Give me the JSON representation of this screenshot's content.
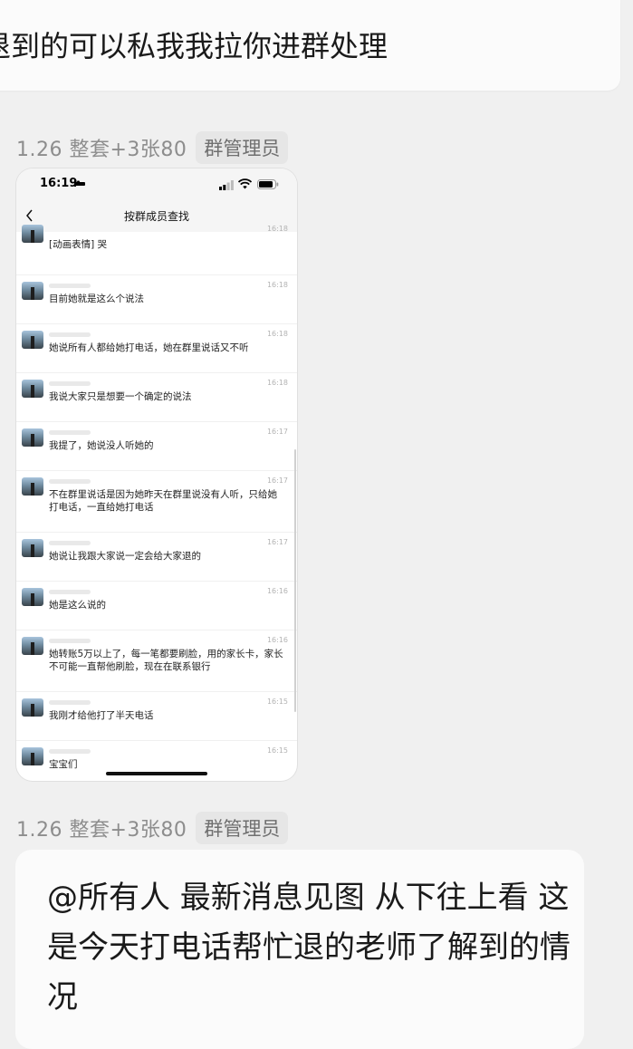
{
  "top_message": {
    "text": "退到的可以私我我拉你进群处理"
  },
  "sender": {
    "name": "1.26 整套+3张80",
    "role": "群管理员"
  },
  "screenshot": {
    "status_time": "16:19",
    "nav_title": "按群成员查找",
    "messages": [
      {
        "time": "16:18",
        "text": "[动画表情] 哭"
      },
      {
        "time": "16:18",
        "text": "目前她就是这么个说法"
      },
      {
        "time": "16:18",
        "text": "她说所有人都给她打电话，她在群里说话又不听"
      },
      {
        "time": "16:18",
        "text": "我说大家只是想要一个确定的说法"
      },
      {
        "time": "16:17",
        "text": "我提了，她说没人听她的"
      },
      {
        "time": "16:17",
        "text": "不在群里说话是因为她昨天在群里说没有人听，只给她打电话，一直给她打电话"
      },
      {
        "time": "16:17",
        "text": "她说让我跟大家说一定会给大家退的"
      },
      {
        "time": "16:16",
        "text": "她是这么说的"
      },
      {
        "time": "16:16",
        "text": "她转账5万以上了，每一笔都要刷脸，用的家长卡，家长不可能一直帮他刷脸，现在在联系银行"
      },
      {
        "time": "16:15",
        "text": "我刚才给他打了半天电话"
      },
      {
        "time": "16:15",
        "text": "宝宝们"
      }
    ]
  },
  "sender2": {
    "name": "1.26 整套+3张80",
    "role": "群管理员"
  },
  "announcement": {
    "text": "@所有人 最新消息见图 从下往上看 这是今天打电话帮忙退的老师了解到的情况"
  }
}
